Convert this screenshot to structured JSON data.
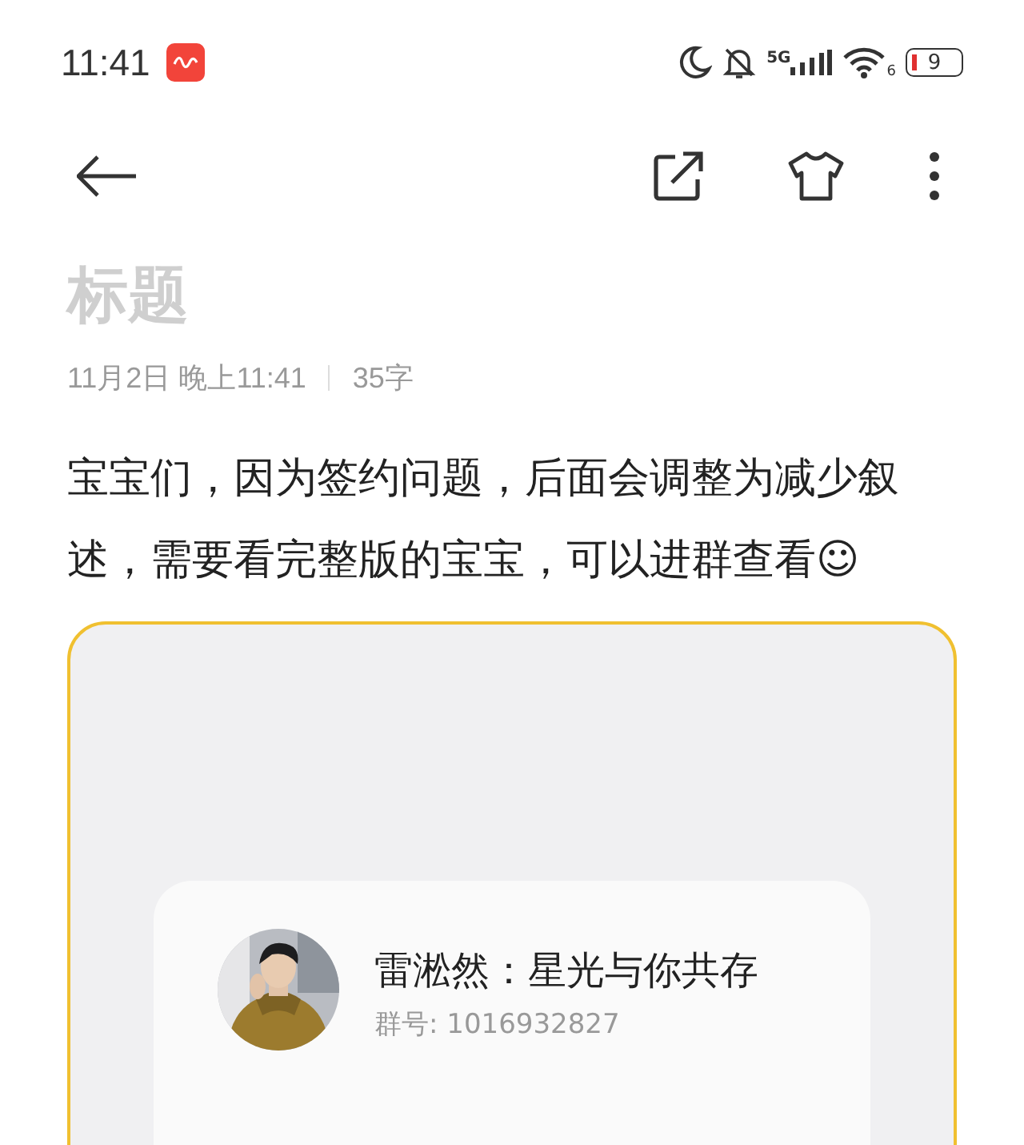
{
  "status_bar": {
    "time": "11:41",
    "network": "5G",
    "wifi_badge": "6",
    "battery": "9"
  },
  "note": {
    "title_placeholder": "标题",
    "date": "11月2日 晚上11:41",
    "word_count": "35字",
    "body": "宝宝们，因为签约问题，后面会调整为减少叙述，需要看完整版的宝宝，可以进群查看☺"
  },
  "group_card": {
    "name": "雷淞然：星光与你共存",
    "group_number": "群号: 1016932827"
  }
}
